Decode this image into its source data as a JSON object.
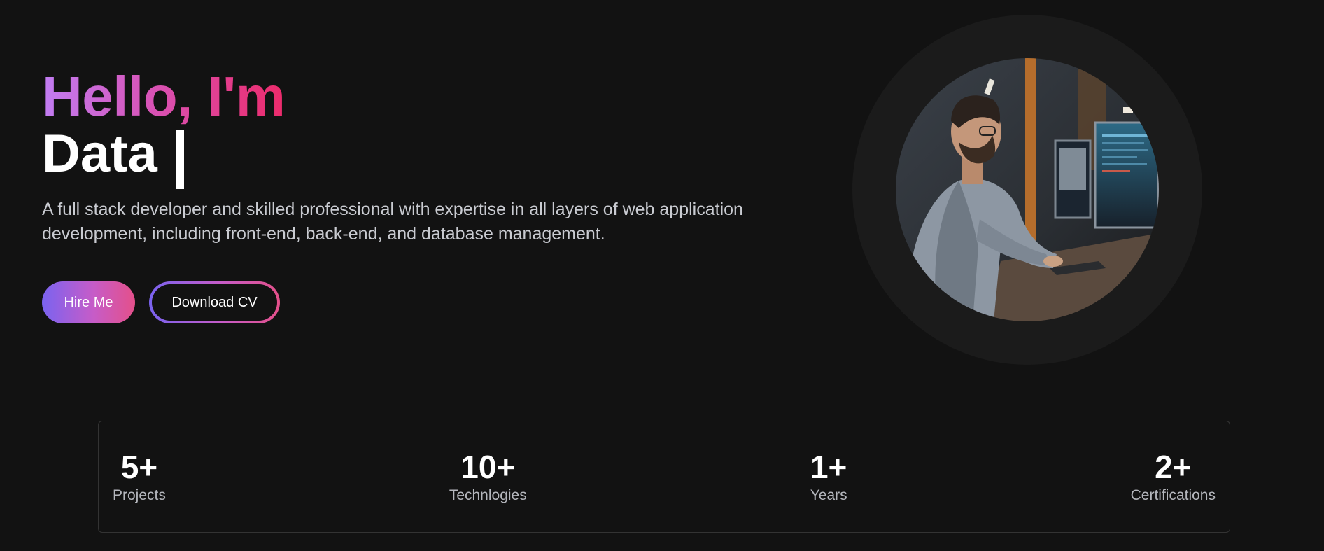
{
  "hero": {
    "greeting": "Hello, I'm",
    "role": "Data",
    "description": "A full stack developer and skilled professional with expertise in all layers of web application development, including front-end, back-end, and database management."
  },
  "actions": {
    "hire_label": "Hire Me",
    "cv_label": "Download CV"
  },
  "stats": [
    {
      "value": "5+",
      "label": "Projects"
    },
    {
      "value": "10+",
      "label": "Technlogies"
    },
    {
      "value": "1+",
      "label": "Years"
    },
    {
      "value": "2+",
      "label": "Certifications"
    }
  ],
  "colors": {
    "background": "#121212",
    "gradient_start": "#c17df3",
    "gradient_end": "#ec2b6b",
    "text_muted": "#c9cbd1"
  }
}
